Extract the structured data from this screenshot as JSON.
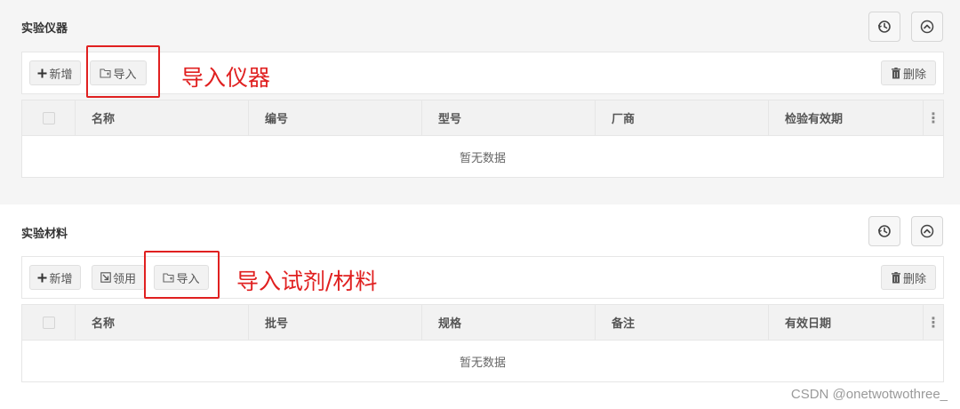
{
  "instruments": {
    "title": "实验仪器",
    "toolbar": {
      "add_label": "新增",
      "import_label": "导入",
      "delete_label": "删除"
    },
    "columns": [
      "名称",
      "编号",
      "型号",
      "厂商",
      "检验有效期"
    ],
    "empty_text": "暂无数据",
    "annotation": "导入仪器"
  },
  "materials": {
    "title": "实验材料",
    "toolbar": {
      "add_label": "新增",
      "claim_label": "领用",
      "import_label": "导入",
      "delete_label": "删除"
    },
    "columns": [
      "名称",
      "批号",
      "规格",
      "备注",
      "有效日期"
    ],
    "empty_text": "暂无数据",
    "annotation": "导入试剂/材料"
  },
  "icons": {
    "history": "history-icon",
    "collapse": "collapse-up-icon",
    "add": "plus-icon",
    "import": "folder-import-icon",
    "claim": "claim-arrow-icon",
    "delete": "trash-icon",
    "more": "vertical-dots-icon"
  },
  "watermark": "CSDN @onetwotwothree_",
  "colors": {
    "annotation": "#e02020",
    "panel_bg": "#f5f5f5",
    "header_bg": "#f2f2f2"
  }
}
